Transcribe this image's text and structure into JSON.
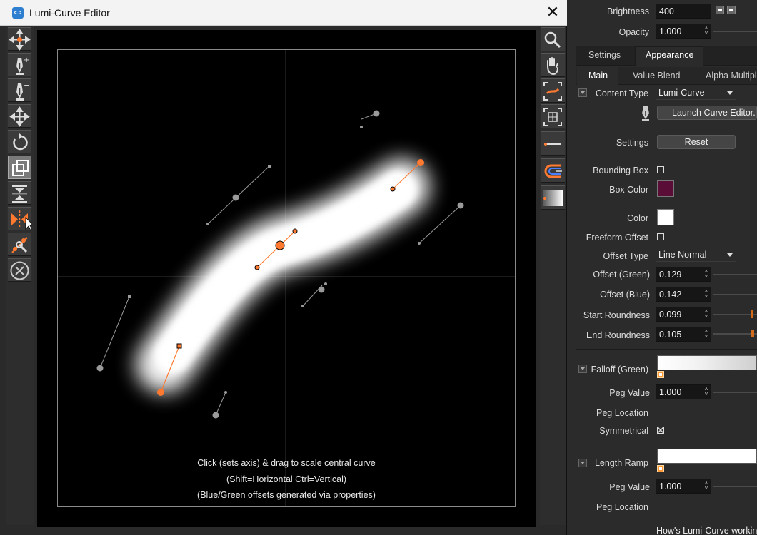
{
  "window": {
    "title": "Lumi-Curve Editor"
  },
  "icons": {
    "left_toolbar": [
      "move-points-icon",
      "pen-add-icon",
      "pen-remove-icon",
      "move-all-icon",
      "rotate-icon",
      "scale-icon",
      "flip-vertical-icon",
      "flip-horizontal-icon",
      "pivot-icon",
      "reset-x-icon"
    ],
    "right_toolbar": [
      "magnify-icon",
      "pan-hand-icon",
      "fit-curve-icon",
      "fit-frame-icon",
      "line-width-icon",
      "magnet-icon",
      "gradient-preview-icon"
    ]
  },
  "colors": {
    "accent": "#ff7a30",
    "box_color": "#5a0d36",
    "slider_handle": "#d06a1c"
  },
  "canvas": {
    "hints": [
      "Click (sets axis) & drag to scale central curve",
      "(Shift=Horizontal Ctrl=Vertical)",
      "(Blue/Green offsets generated via properties)"
    ]
  },
  "panel": {
    "brightness": {
      "label": "Brightness",
      "value": "400"
    },
    "opacity": {
      "label": "Opacity",
      "value": "1.000"
    },
    "top_tabs": [
      "Settings",
      "Appearance"
    ],
    "sub_tabs": [
      "Main",
      "Value Blend",
      "Alpha Multipl"
    ],
    "content_type": {
      "label": "Content Type",
      "value": "Lumi-Curve"
    },
    "launch_button": "Launch Curve Editor...",
    "settings": {
      "label": "Settings",
      "button": "Reset"
    },
    "bounding_box": {
      "label": "Bounding Box",
      "checked": false
    },
    "box_color": {
      "label": "Box Color"
    },
    "color": {
      "label": "Color"
    },
    "freeform_offset": {
      "label": "Freeform Offset",
      "checked": false
    },
    "offset_type": {
      "label": "Offset Type",
      "value": "Line Normal"
    },
    "offset_green": {
      "label": "Offset (Green)",
      "value": "0.129"
    },
    "offset_blue": {
      "label": "Offset (Blue)",
      "value": "0.142"
    },
    "start_roundness": {
      "label": "Start Roundness",
      "value": "0.099",
      "level": 0.92
    },
    "end_roundness": {
      "label": "End Roundness",
      "value": "0.105",
      "level": 0.93
    },
    "falloff_green": {
      "label": "Falloff (Green)"
    },
    "peg_value_1": {
      "label": "Peg Value",
      "value": "1.000"
    },
    "peg_location_1": {
      "label": "Peg Location"
    },
    "symmetrical": {
      "label": "Symmetrical",
      "checked": true
    },
    "length_ramp": {
      "label": "Length Ramp"
    },
    "peg_value_2": {
      "label": "Peg Value",
      "value": "1.000"
    },
    "peg_location_2": {
      "label": "Peg Location"
    },
    "help_link": "How's Lumi-Curve working"
  }
}
